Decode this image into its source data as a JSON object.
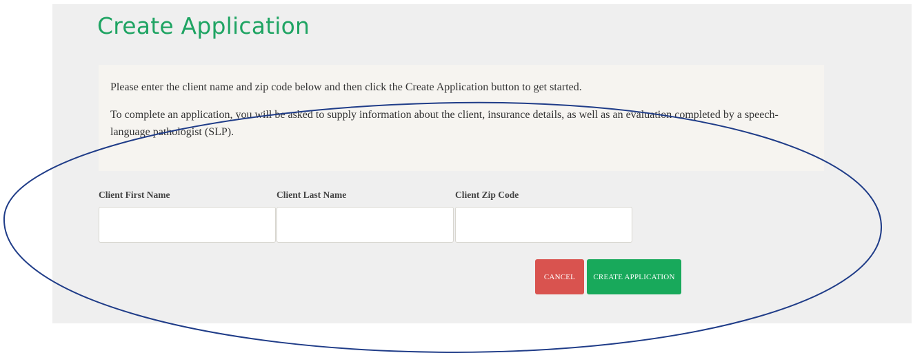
{
  "page": {
    "title": "Create Application"
  },
  "info": {
    "intro": "Please enter the client name and zip code below and then click the Create Application button to get started.",
    "details": "To complete an application, you will be asked to supply information about the client, insurance details, as well as an evaluation completed by a speech-language pathologist (SLP)."
  },
  "form": {
    "first_name": {
      "label": "Client First Name",
      "value": "",
      "placeholder": ""
    },
    "last_name": {
      "label": "Client Last Name",
      "value": "",
      "placeholder": ""
    },
    "zip_code": {
      "label": "Client Zip Code",
      "value": "",
      "placeholder": ""
    }
  },
  "actions": {
    "cancel_label": "Cancel",
    "create_label": "Create Application"
  },
  "colors": {
    "title_green": "#1fa463",
    "cancel_red": "#d9534f",
    "create_green": "#18a95b",
    "annotation_blue": "#1f3c88"
  }
}
